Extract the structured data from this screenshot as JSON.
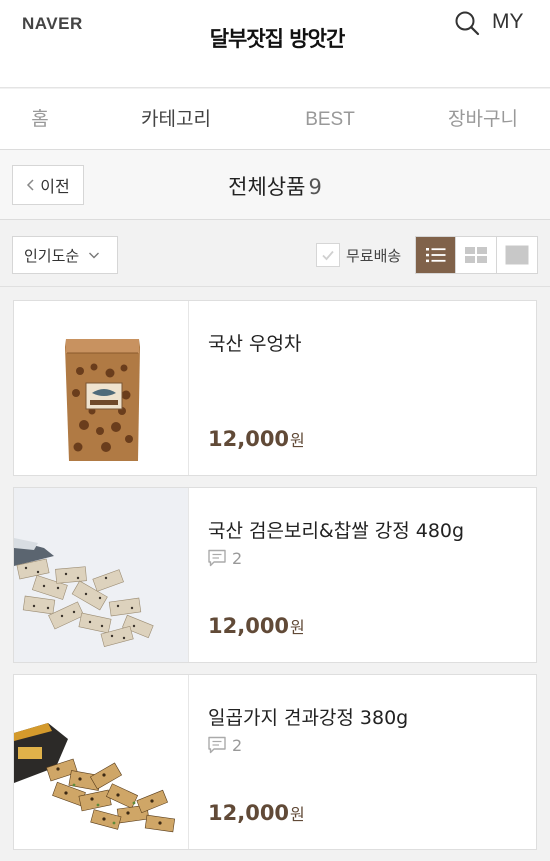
{
  "header": {
    "naver_logo": "NAVER",
    "brand_logo": "달부잣집 방앗간",
    "my_label": "MY",
    "search_icon": "search-icon"
  },
  "nav": {
    "tabs": [
      {
        "label": "홈"
      },
      {
        "label": "카테고리",
        "active": true
      },
      {
        "label": "BEST"
      },
      {
        "label": "장바구니"
      }
    ]
  },
  "subhead": {
    "back_label": "이전",
    "title": "전체상품",
    "count": "9"
  },
  "toolbar": {
    "sort_label": "인기도순",
    "free_shipping_label": "무료배송",
    "free_shipping_checked": false,
    "view_modes": [
      {
        "icon": "list-view-icon",
        "active": true
      },
      {
        "icon": "grid-view-icon",
        "active": false
      },
      {
        "icon": "image-view-icon",
        "active": false
      }
    ]
  },
  "products": [
    {
      "name": "국산 우엉차",
      "price": "12,000",
      "currency": "원",
      "reviews": null
    },
    {
      "name": "국산 검은보리&찹쌀 강정 480g",
      "price": "12,000",
      "currency": "원",
      "reviews": "2"
    },
    {
      "name": "일곱가지 견과강정 380g",
      "price": "12,000",
      "currency": "원",
      "reviews": "2"
    }
  ],
  "colors": {
    "accent_brown": "#80624a",
    "price_brown": "#614a37",
    "brand_red": "#d21c1c"
  }
}
